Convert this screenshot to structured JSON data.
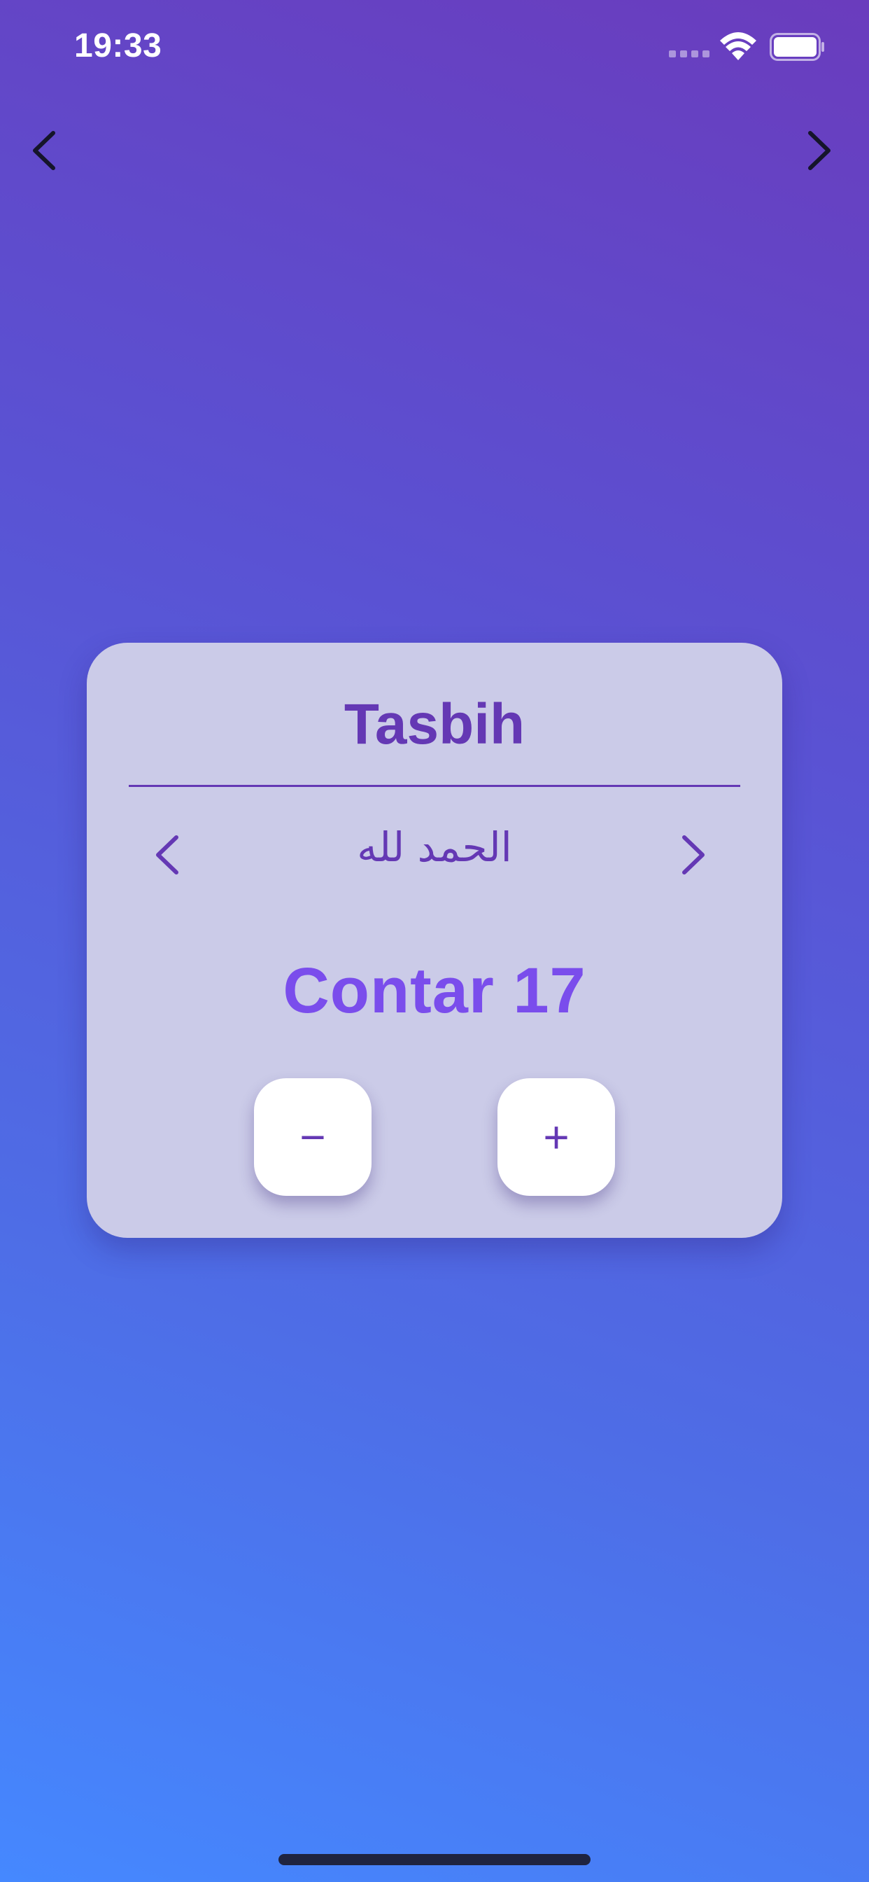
{
  "status_bar": {
    "time": "19:33"
  },
  "navigation": {
    "prev_icon": "chevron-left-icon",
    "next_icon": "chevron-right-icon"
  },
  "card": {
    "title": "Tasbih",
    "phrase": "الحمد لله",
    "count_text": "Contar 17",
    "decrement_label": "−",
    "increment_label": "+"
  },
  "colors": {
    "background_top": "#6a3cbd",
    "background_bottom": "#4588ff",
    "card_background": "#cbcbe8",
    "accent_purple": "#6438b4",
    "count_purple": "#7a4dec",
    "button_background": "#ffffff"
  }
}
